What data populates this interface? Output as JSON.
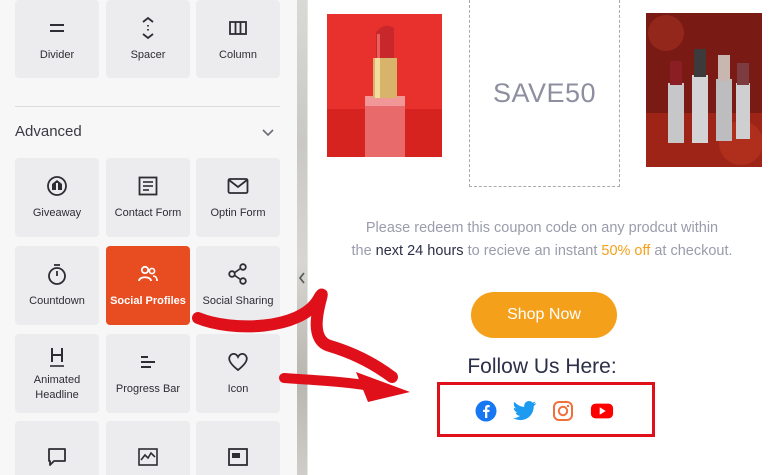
{
  "sidebar": {
    "top_row": [
      {
        "label": "Divider",
        "icon": "divider-icon"
      },
      {
        "label": "Spacer",
        "icon": "spacer-icon"
      },
      {
        "label": "Column",
        "icon": "column-icon"
      }
    ],
    "section_title": "Advanced",
    "blocks": [
      {
        "label": "Giveaway",
        "icon": "giveaway-icon"
      },
      {
        "label": "Contact Form",
        "icon": "contact-form-icon"
      },
      {
        "label": "Optin Form",
        "icon": "optin-form-icon"
      },
      {
        "label": "Countdown",
        "icon": "countdown-icon"
      },
      {
        "label": "Social Profiles",
        "icon": "social-profiles-icon",
        "active": true
      },
      {
        "label": "Social Sharing",
        "icon": "share-icon"
      },
      {
        "label": "Animated Headline",
        "icon": "animated-headline-icon"
      },
      {
        "label": "Progress Bar",
        "icon": "progress-bar-icon"
      },
      {
        "label": "Icon",
        "icon": "heart-icon"
      }
    ],
    "bottom_row_icons": [
      "comment-icon",
      "chart-icon",
      "window-icon"
    ],
    "active_color": "#e84d22"
  },
  "preview": {
    "coupon_code": "SAVE50",
    "redeem_line1": "Please redeem this coupon code on any prodcut within",
    "redeem_line2_a": "the ",
    "redeem_line2_b": "next 24 hours",
    "redeem_line2_c": " to recieve an instant ",
    "redeem_line2_d": "50% off",
    "redeem_line2_e": " at checkout.",
    "shop_button": "Shop Now",
    "follow_heading": "Follow Us Here:",
    "social_icons": [
      "facebook-icon",
      "twitter-icon",
      "instagram-icon",
      "youtube-icon"
    ],
    "accent_color": "#f5a01a",
    "highlight_color": "#e0101a"
  }
}
